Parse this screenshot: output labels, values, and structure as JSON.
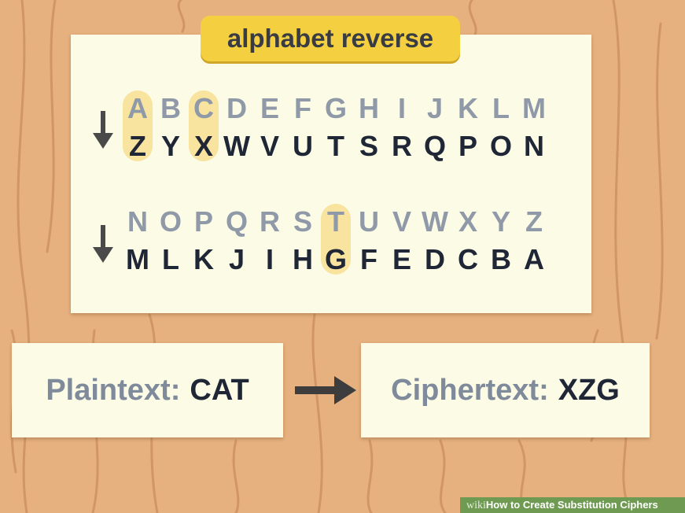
{
  "title": "alphabet reverse",
  "colors": {
    "wood": "#e6b07f",
    "card": "#fbfbe6",
    "title_tag": "#f4cf3f",
    "highlight": "#f8e39f",
    "plain_letter": "#8f99a8",
    "cipher_letter": "#1f2636"
  },
  "icons": [
    "down-arrow-icon",
    "right-arrow-icon"
  ],
  "rows": [
    {
      "plain": [
        "A",
        "B",
        "C",
        "D",
        "E",
        "F",
        "G",
        "H",
        "I",
        "J",
        "K",
        "L",
        "M"
      ],
      "cipher": [
        "Z",
        "Y",
        "X",
        "W",
        "V",
        "U",
        "T",
        "S",
        "R",
        "Q",
        "P",
        "O",
        "N"
      ],
      "highlighted": [
        "A",
        "C"
      ]
    },
    {
      "plain": [
        "N",
        "O",
        "P",
        "Q",
        "R",
        "S",
        "T",
        "U",
        "V",
        "W",
        "X",
        "Y",
        "Z"
      ],
      "cipher": [
        "M",
        "L",
        "K",
        "J",
        "I",
        "H",
        "G",
        "F",
        "E",
        "D",
        "C",
        "B",
        "A"
      ],
      "highlighted": [
        "T"
      ]
    }
  ],
  "example": {
    "plain_label": "Plaintext:",
    "plain_value": "CAT",
    "cipher_label": "Ciphertext:",
    "cipher_value": "XZG"
  },
  "watermark": {
    "site": "wiki",
    "how": "How",
    "rest": " to Create Substitution Ciphers"
  }
}
